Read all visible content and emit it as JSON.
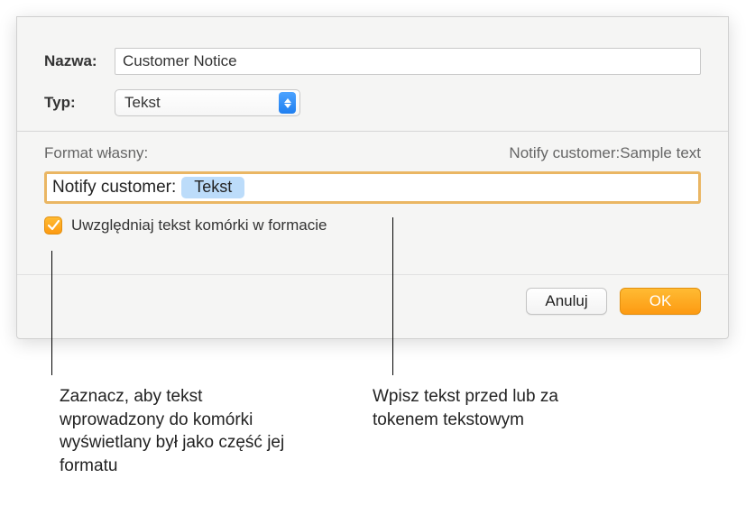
{
  "labels": {
    "name": "Nazwa:",
    "type": "Typ:",
    "formatOwn": "Format własny:",
    "checkbox": "Uwzględniaj tekst komórki w formacie"
  },
  "values": {
    "name": "Customer Notice",
    "type": "Tekst",
    "preview": "Notify customer:Sample text",
    "formatText": "Notify customer:",
    "token": "Tekst"
  },
  "buttons": {
    "cancel": "Anuluj",
    "ok": "OK"
  },
  "callouts": {
    "left": "Zaznacz, aby tekst wprowadzony do komórki wyświetlany był jako część jej formatu",
    "right": "Wpisz tekst przed lub za tokenem tekstowym"
  }
}
